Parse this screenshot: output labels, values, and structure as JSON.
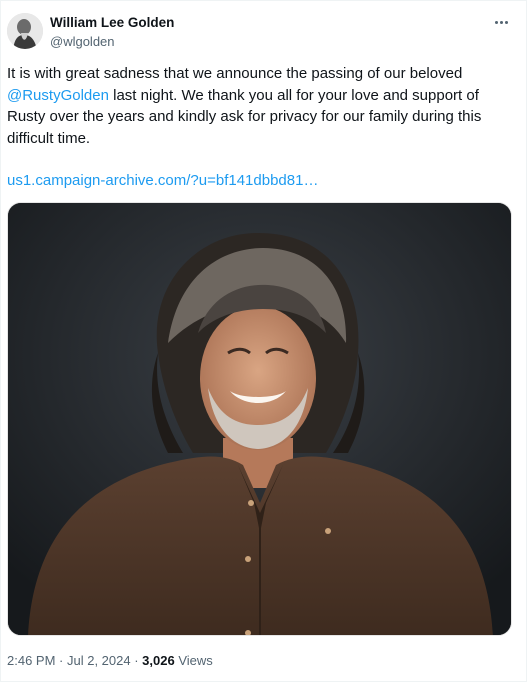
{
  "author": {
    "display_name": "William Lee Golden",
    "handle": "@wlgolden"
  },
  "post": {
    "text_before": "It is with great sadness that we announce the passing of our beloved ",
    "mention": "@RustyGolden",
    "text_after": " last night. We thank you all for your love and support of Rusty over the years and kindly ask for privacy for our family during this difficult time.",
    "link": "us1.campaign-archive.com/?u=bf141dbbd81…"
  },
  "meta": {
    "time": "2:46 PM",
    "separator": " · ",
    "date": "Jul 2, 2024",
    "views_count": "3,026",
    "views_label": " Views"
  },
  "icons": {
    "more": "more-options-icon"
  }
}
